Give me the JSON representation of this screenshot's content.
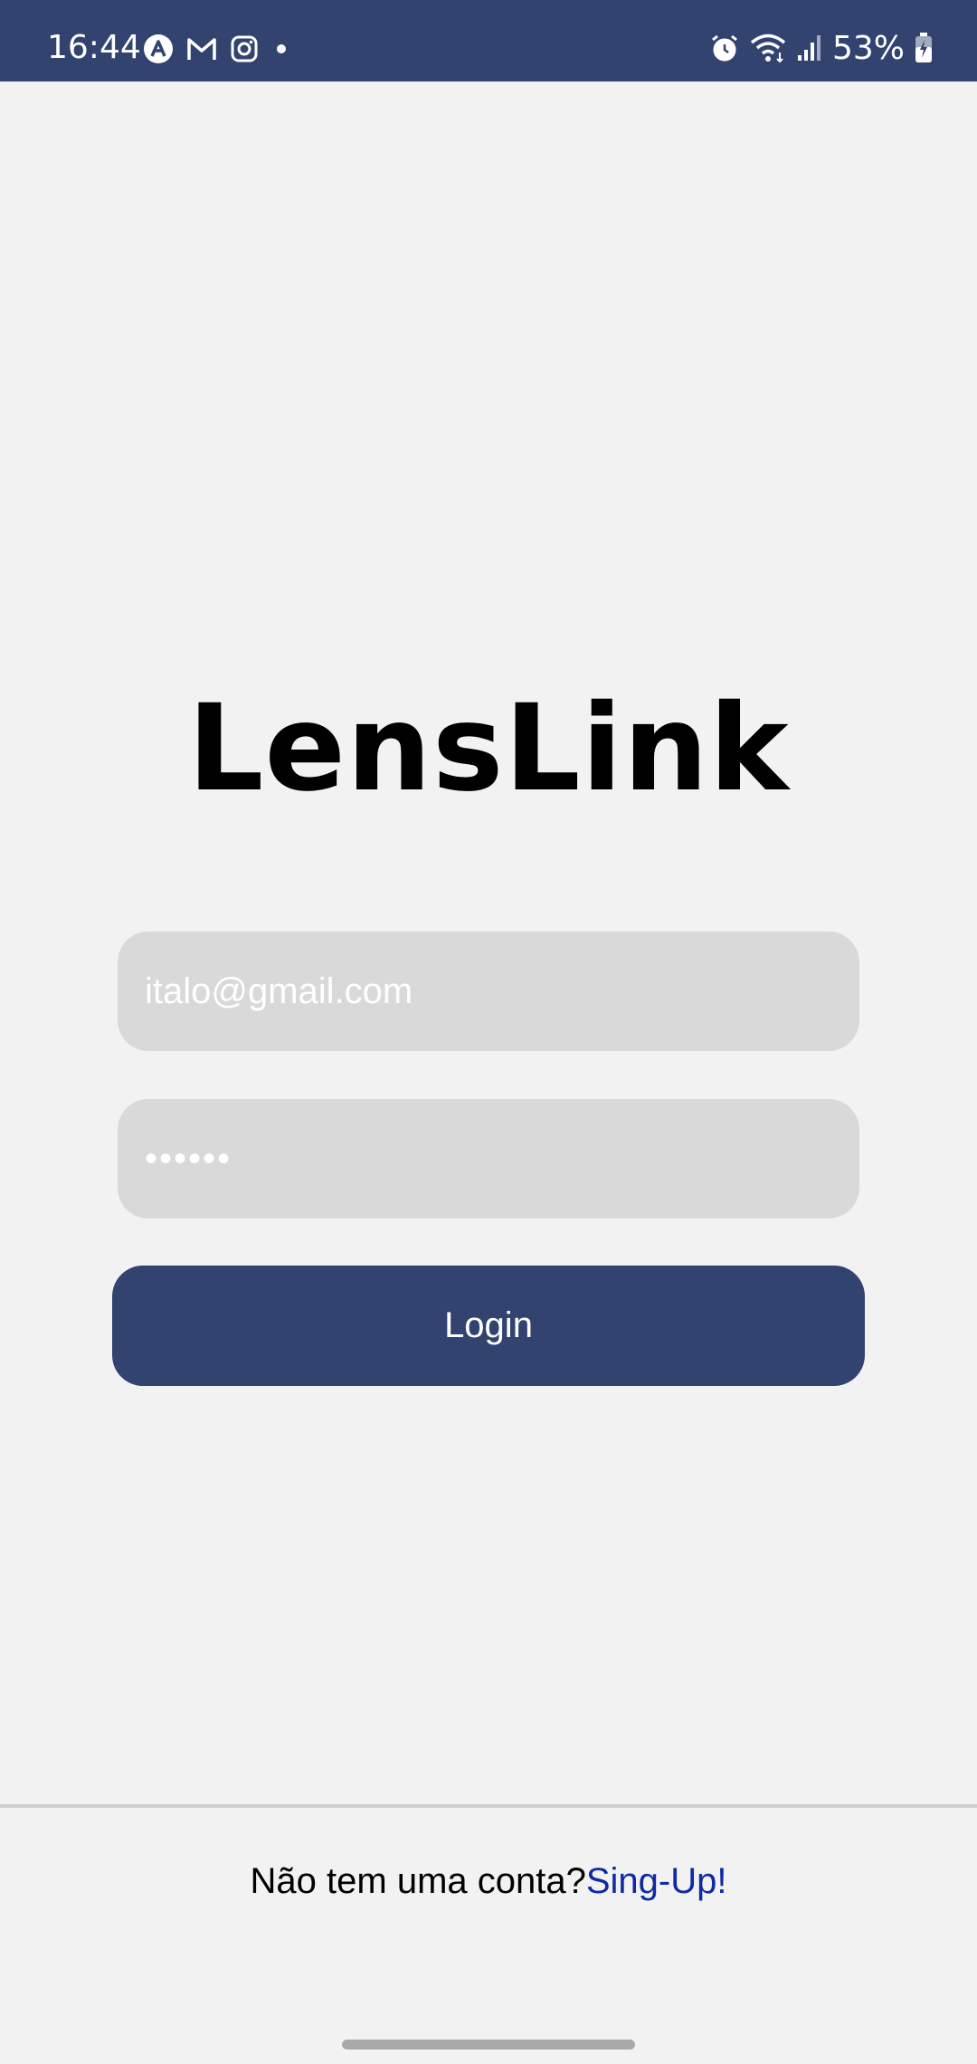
{
  "status_bar": {
    "time": "16:44",
    "battery": "53%",
    "icons_left": [
      "app-a-icon",
      "gmail-icon",
      "instagram-icon",
      "dot-icon"
    ],
    "icons_right": [
      "alarm-icon",
      "wifi-icon",
      "signal-icon",
      "battery-icon"
    ],
    "background": "#324370"
  },
  "app": {
    "title": "LensLink"
  },
  "form": {
    "email_value": "italo@gmail.com",
    "password_value": "••••••",
    "login_label": "Login",
    "button_color": "#324370",
    "field_color": "#d9d9d9"
  },
  "footer": {
    "prompt": "Não tem uma conta?",
    "signup_link": "Sing-Up!",
    "link_color": "#0f2aa3"
  }
}
